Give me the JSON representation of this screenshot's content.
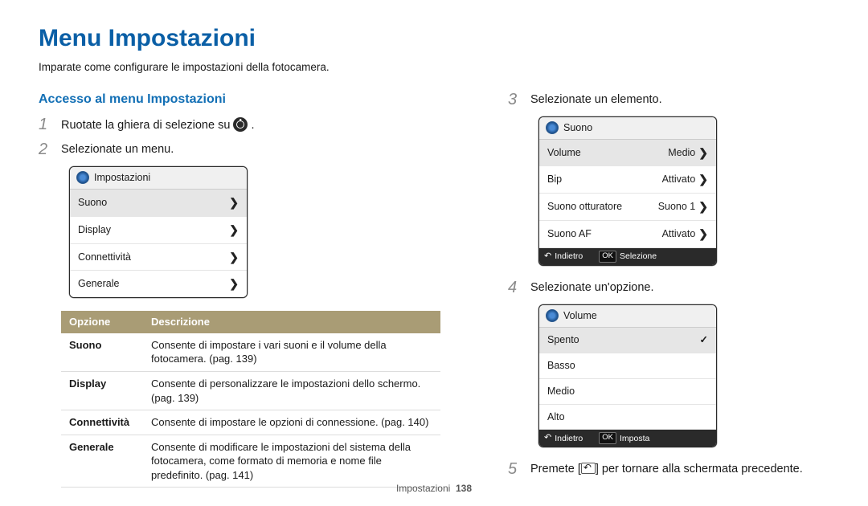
{
  "title": "Menu Impostazioni",
  "intro": "Imparate come configurare le impostazioni della fotocamera.",
  "subtitle": "Accesso al menu Impostazioni",
  "left": {
    "step1_a": "Ruotate la ghiera di selezione su",
    "step1_b": ".",
    "step2": "Selezionate un menu.",
    "menu": {
      "title": "Impostazioni",
      "rows": [
        "Suono",
        "Display",
        "Connettività",
        "Generale"
      ]
    }
  },
  "table": {
    "h1": "Opzione",
    "h2": "Descrizione",
    "rows": [
      {
        "opt": "Suono",
        "desc": "Consente di impostare i vari suoni e il volume della fotocamera. (pag. 139)"
      },
      {
        "opt": "Display",
        "desc": "Consente di personalizzare le impostazioni dello schermo. (pag. 139)"
      },
      {
        "opt": "Connettività",
        "desc": "Consente di impostare le opzioni di connessione. (pag. 140)"
      },
      {
        "opt": "Generale",
        "desc": "Consente di modificare le impostazioni del sistema della fotocamera, come formato di memoria e nome file predefinito. (pag. 141)"
      }
    ]
  },
  "right": {
    "step3": "Selezionate un elemento.",
    "menu3": {
      "title": "Suono",
      "rows": [
        {
          "label": "Volume",
          "value": "Medio",
          "sel": true
        },
        {
          "label": "Bip",
          "value": "Attivato"
        },
        {
          "label": "Suono otturatore",
          "value": "Suono 1"
        },
        {
          "label": "Suono AF",
          "value": "Attivato"
        }
      ],
      "foot_l": "Indietro",
      "foot_r": "Selezione"
    },
    "step4": "Selezionate un'opzione.",
    "menu4": {
      "title": "Volume",
      "rows": [
        {
          "label": "Spento",
          "check": true
        },
        {
          "label": "Basso"
        },
        {
          "label": "Medio"
        },
        {
          "label": "Alto"
        }
      ],
      "foot_l": "Indietro",
      "foot_r": "Imposta"
    },
    "step5_a": "Premete [",
    "step5_b": "] per tornare alla schermata precedente."
  },
  "footer": {
    "section": "Impostazioni",
    "page": "138"
  },
  "ok_label": "OK"
}
